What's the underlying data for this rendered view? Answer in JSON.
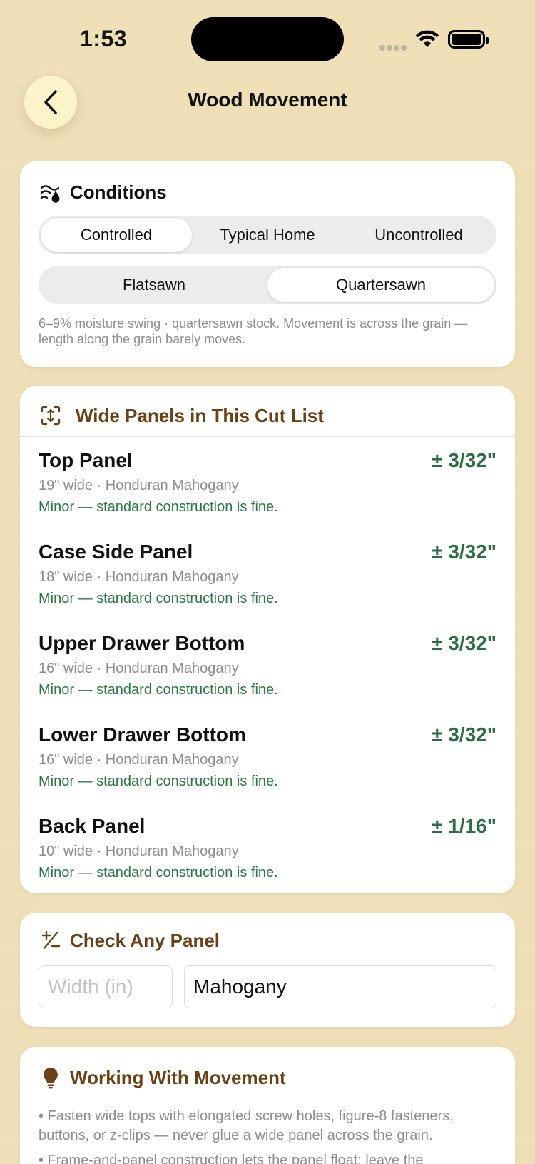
{
  "status": {
    "time": "1:53"
  },
  "nav": {
    "title": "Wood Movement"
  },
  "conditions": {
    "title": "Conditions",
    "humidity_options": [
      "Controlled",
      "Typical Home",
      "Uncontrolled"
    ],
    "humidity_selected": "Controlled",
    "cut_options": [
      "Flatsawn",
      "Quartersawn"
    ],
    "cut_selected": "Quartersawn",
    "description": "6–9% moisture swing · quartersawn stock. Movement is across the grain — length along the grain barely moves."
  },
  "panels": {
    "title": "Wide Panels in This Cut List",
    "items": [
      {
        "name": "Top Panel",
        "sub": "19\" wide · Honduran Mahogany",
        "note": "Minor — standard construction is fine.",
        "movement": "± 3/32\""
      },
      {
        "name": "Case Side Panel",
        "sub": "18\" wide · Honduran Mahogany",
        "note": "Minor — standard construction is fine.",
        "movement": "± 3/32\""
      },
      {
        "name": "Upper Drawer Bottom",
        "sub": "16\" wide · Honduran Mahogany",
        "note": "Minor — standard construction is fine.",
        "movement": "± 3/32\""
      },
      {
        "name": "Lower Drawer Bottom",
        "sub": "16\" wide · Honduran Mahogany",
        "note": "Minor — standard construction is fine.",
        "movement": "± 3/32\""
      },
      {
        "name": "Back Panel",
        "sub": "10\" wide · Honduran Mahogany",
        "note": "Minor — standard construction is fine.",
        "movement": "± 1/16\""
      }
    ]
  },
  "check": {
    "title": "Check Any Panel",
    "width_placeholder": "Width (in)",
    "width_value": "",
    "species_value": "Mahogany"
  },
  "tips": {
    "title": "Working With Movement",
    "items": [
      "• Fasten wide tops with elongated screw holes, figure-8 fasteners, buttons, or z-clips — never glue a wide panel across the grain.",
      "• Frame-and-panel construction lets the panel float; leave the"
    ]
  },
  "colors": {
    "background": "#efdfb7",
    "accent_brown": "#6a4215",
    "accent_green": "#2b7a45",
    "back_button": "#fdf3c8"
  }
}
